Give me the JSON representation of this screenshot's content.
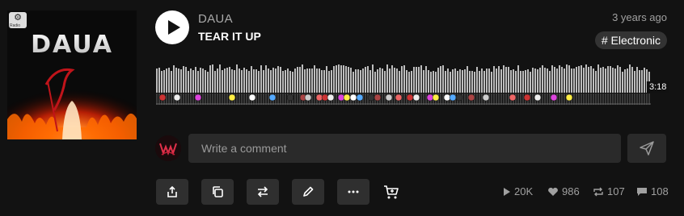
{
  "artwork": {
    "title_text": "DAUA",
    "badge_label": "Radio"
  },
  "track": {
    "artist": "DAUA",
    "title": "TEAR IT UP",
    "uploaded": "3 years ago",
    "tag": "# Electronic",
    "duration": "3:18"
  },
  "comment": {
    "placeholder": "Write a comment"
  },
  "actions": {
    "share": "share-icon",
    "copy": "copy-icon",
    "repost": "repost-icon",
    "edit": "pencil-icon",
    "more": "more-icon",
    "buy": "cart-icon"
  },
  "stats": {
    "plays": "20K",
    "likes": "986",
    "reposts": "107",
    "comments": "108"
  }
}
